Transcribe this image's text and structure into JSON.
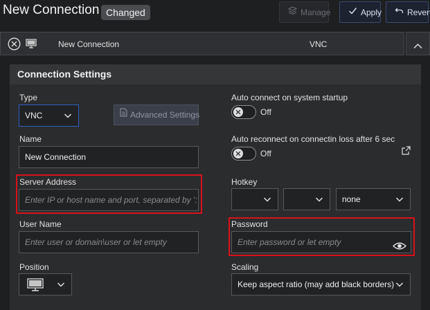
{
  "header": {
    "title": "New Connection",
    "badge": "Changed",
    "manage_label": "Manage",
    "apply_label": "Apply",
    "revert_label": "Revert"
  },
  "connection_bar": {
    "name": "New Connection",
    "type": "VNC"
  },
  "panel": {
    "title": "Connection Settings",
    "type_label": "Type",
    "type_value": "VNC",
    "advanced_settings_label": "Advanced Settings",
    "name_label": "Name",
    "name_value": "New Connection",
    "server_address_label": "Server Address",
    "server_address_placeholder": "Enter IP or host name and port, separated by ':'",
    "user_name_label": "User Name",
    "user_name_placeholder": "Enter user or domain\\user or let empty",
    "position_label": "Position",
    "auto_connect_label": "Auto connect on system startup",
    "auto_connect_state": "Off",
    "auto_reconnect_label": "Auto reconnect on connectin loss after 6 sec",
    "auto_reconnect_state": "Off",
    "hotkey_label": "Hotkey",
    "hotkey_key_value": "none",
    "password_label": "Password",
    "password_placeholder": "Enter password or let empty",
    "scaling_label": "Scaling",
    "scaling_value": "Keep aspect ratio (may add black borders)"
  },
  "colors": {
    "background": "#1e1f21",
    "panel": "#2b2c2e",
    "accent": "#2f5fc4",
    "highlight": "#d9111a"
  },
  "icons": [
    "close-circle-icon",
    "monitor-icon",
    "chevron-up-icon",
    "stack-icon",
    "check-icon",
    "undo-icon",
    "document-icon",
    "external-link-icon",
    "eye-icon",
    "chevron-down-icon",
    "x-icon"
  ]
}
